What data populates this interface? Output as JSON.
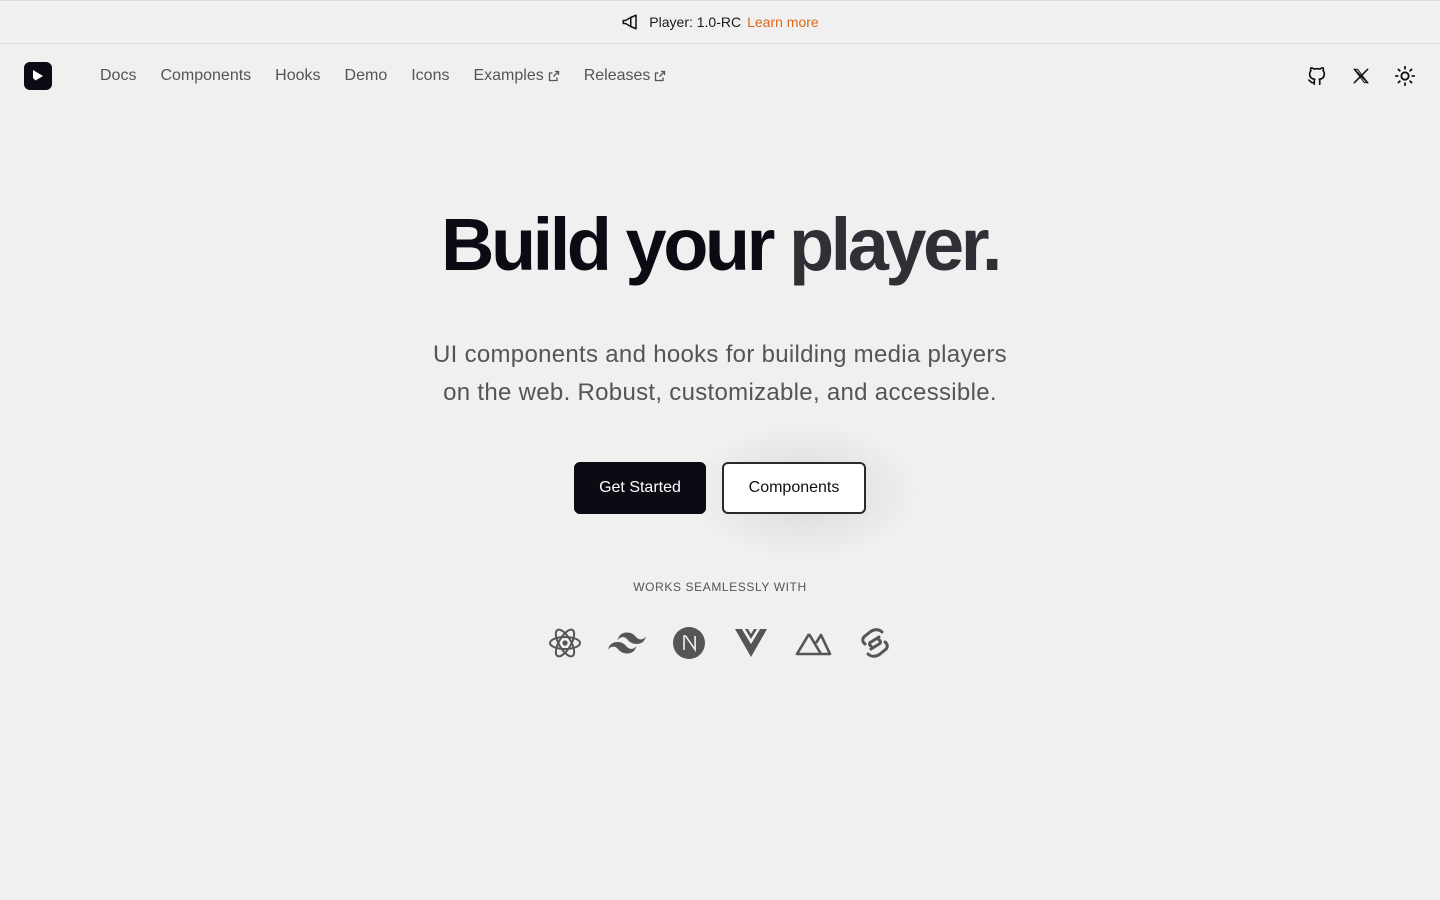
{
  "announcement": {
    "icon": "megaphone-icon",
    "text": "Player: 1.0-RC",
    "link": "Learn more",
    "link_color": "#d96a1f"
  },
  "header": {
    "logo": "vidstack-logo",
    "nav": [
      {
        "label": "Docs",
        "external": false
      },
      {
        "label": "Components",
        "external": false
      },
      {
        "label": "Hooks",
        "external": false
      },
      {
        "label": "Demo",
        "external": false
      },
      {
        "label": "Icons",
        "external": false
      },
      {
        "label": "Examples",
        "external": true
      },
      {
        "label": "Releases",
        "external": true
      }
    ],
    "icons": [
      "github-icon",
      "x-twitter-icon",
      "sun-icon"
    ]
  },
  "hero": {
    "title_part1": "Build your",
    "title_part2": "player.",
    "subtitle_line1": "UI components and hooks for building media players",
    "subtitle_line2": "on the web. Robust, customizable, and accessible.",
    "primary_button": "Get Started",
    "secondary_button": "Components",
    "works_with": "WORKS SEAMLESSLY WITH",
    "tech_icons": [
      "react-icon",
      "tailwind-icon",
      "nextjs-icon",
      "vue-icon",
      "nuxt-icon",
      "svelte-icon"
    ]
  },
  "colors": {
    "background": "#f0f0f0",
    "primary": "#0b0b14",
    "accent": "#d96a1f"
  }
}
